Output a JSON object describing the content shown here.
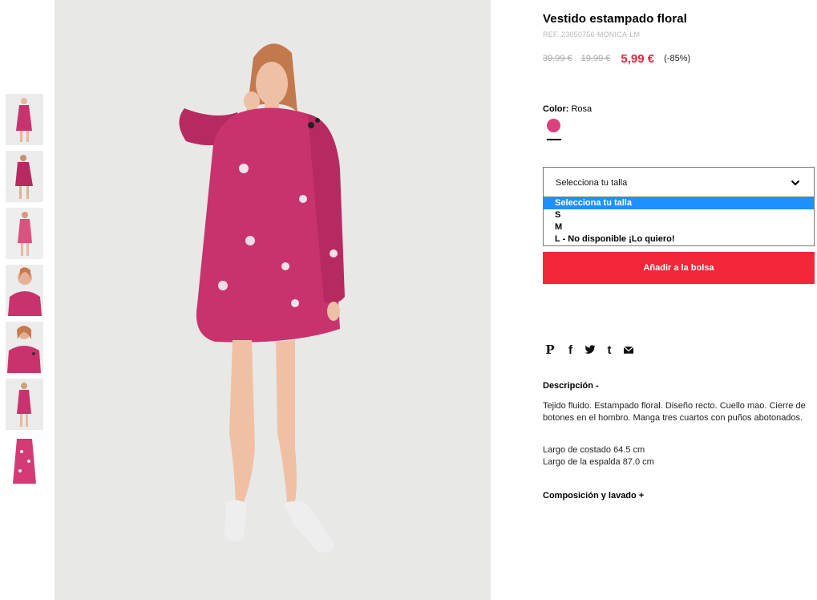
{
  "product": {
    "title": "Vestido estampado floral",
    "ref": "REF. 23050756-MONICA-LM",
    "old_price_1": "39,99 €",
    "old_price_2": "19,99 €",
    "sale_price": "5,99 €",
    "discount": "(-85%)"
  },
  "color": {
    "label": "Color:",
    "value": "Rosa",
    "swatch_hex": "#dc3f7e"
  },
  "size_select": {
    "current": "Selecciona tu talla",
    "options": [
      "Selecciona tu talla",
      "S",
      "M",
      "L - No disponible ¡Lo quiero!"
    ]
  },
  "add_to_bag": "Añadir a la bolsa",
  "social": {
    "pinterest": "P",
    "facebook": "f",
    "twitter": "twitter-icon",
    "tumblr": "t",
    "email": "mail-icon"
  },
  "description": {
    "title": "Descripción -",
    "text": "Tejido fluido. Estampado floral. Diseño recto. Cuello mao. Cierre de botones en el hombro. Manga tres cuartos con puños abotonados.",
    "measure_1": "Largo de costado 64.5 cm",
    "measure_2": "Largo de la espalda 87.0 cm"
  },
  "composition_title": "Composición y lavado +",
  "colors": {
    "accent": "#f3263a",
    "sale": "#e8273d",
    "dress": "#c8336e",
    "select_highlight": "#1e90ff"
  }
}
